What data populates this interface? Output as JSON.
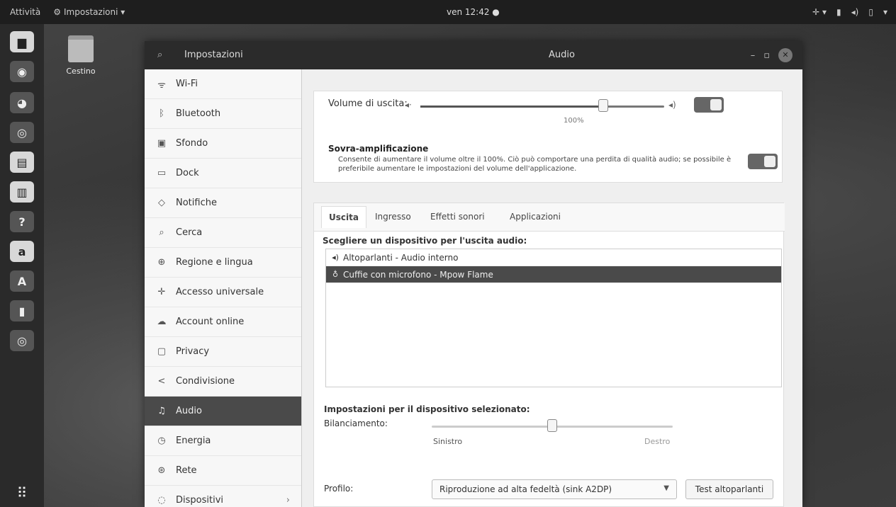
{
  "topbar": {
    "activities": "Attività",
    "app_menu": "Impostazioni ▾",
    "clock": "ven 12:42 ●",
    "tray_icons": [
      "accessibility-icon",
      "network-icon",
      "volume-icon",
      "battery-icon",
      "system-menu-icon"
    ]
  },
  "desktop": {
    "trash_label": "Cestino"
  },
  "dock": {
    "items": [
      "files-icon",
      "firefox-icon",
      "thunderbird-icon",
      "rhythmbox-icon",
      "libreoffice-writer-icon",
      "libreoffice-impress-icon",
      "help-icon",
      "amazon-icon",
      "software-icon",
      "usb-icon",
      "disc-icon"
    ],
    "show_apps": "⠿"
  },
  "window": {
    "app_title": "Impostazioni",
    "page_title": "Audio"
  },
  "sidebar": {
    "items": [
      {
        "label": "Wi-Fi",
        "icon": "wifi-icon"
      },
      {
        "label": "Bluetooth",
        "icon": "bluetooth-icon"
      },
      {
        "label": "Sfondo",
        "icon": "background-icon"
      },
      {
        "label": "Dock",
        "icon": "dock-icon"
      },
      {
        "label": "Notifiche",
        "icon": "notifications-icon"
      },
      {
        "label": "Cerca",
        "icon": "search-icon"
      },
      {
        "label": "Regione e lingua",
        "icon": "region-icon"
      },
      {
        "label": "Accesso universale",
        "icon": "accessibility-icon"
      },
      {
        "label": "Account online",
        "icon": "cloud-icon"
      },
      {
        "label": "Privacy",
        "icon": "privacy-icon"
      },
      {
        "label": "Condivisione",
        "icon": "share-icon"
      },
      {
        "label": "Audio",
        "icon": "music-icon"
      },
      {
        "label": "Energia",
        "icon": "power-icon"
      },
      {
        "label": "Rete",
        "icon": "network-icon"
      },
      {
        "label": "Dispositivi",
        "icon": "devices-icon"
      }
    ],
    "active_index": 11
  },
  "volume": {
    "label": "Volume di uscita:",
    "percent_label": "100%",
    "level": 0.75,
    "mute_toggle_on": true
  },
  "amplification": {
    "title": "Sovra-amplificazione",
    "description": "Consente di aumentare il volume oltre il 100%. Ciò può comportare una perdita di qualità audio; se possibile è preferibile aumentare le impostazioni del volume dell'applicazione.",
    "toggle_on": true
  },
  "tabs": {
    "output": "Uscita",
    "input": "Ingresso",
    "sound_effects": "Effetti sonori",
    "applications": "Applicazioni"
  },
  "output": {
    "choose_label": "Scegliere un dispositivo per l'uscita audio:",
    "devices": [
      {
        "label": "Altoparlanti - Audio interno",
        "icon": "speaker-icon",
        "selected": false
      },
      {
        "label": "Cuffie con microfono - Mpow Flame",
        "icon": "headset-icon",
        "selected": true
      }
    ],
    "settings_label": "Impostazioni per il dispositivo selezionato:",
    "balance_label": "Bilanciamento:",
    "balance_left": "Sinistro",
    "balance_right": "Destro",
    "balance_value": 0.5,
    "profile_label": "Profilo:",
    "profile_value": "Riproduzione ad alta fedeltà (sink A2DP)",
    "test_button": "Test altoparlanti"
  }
}
